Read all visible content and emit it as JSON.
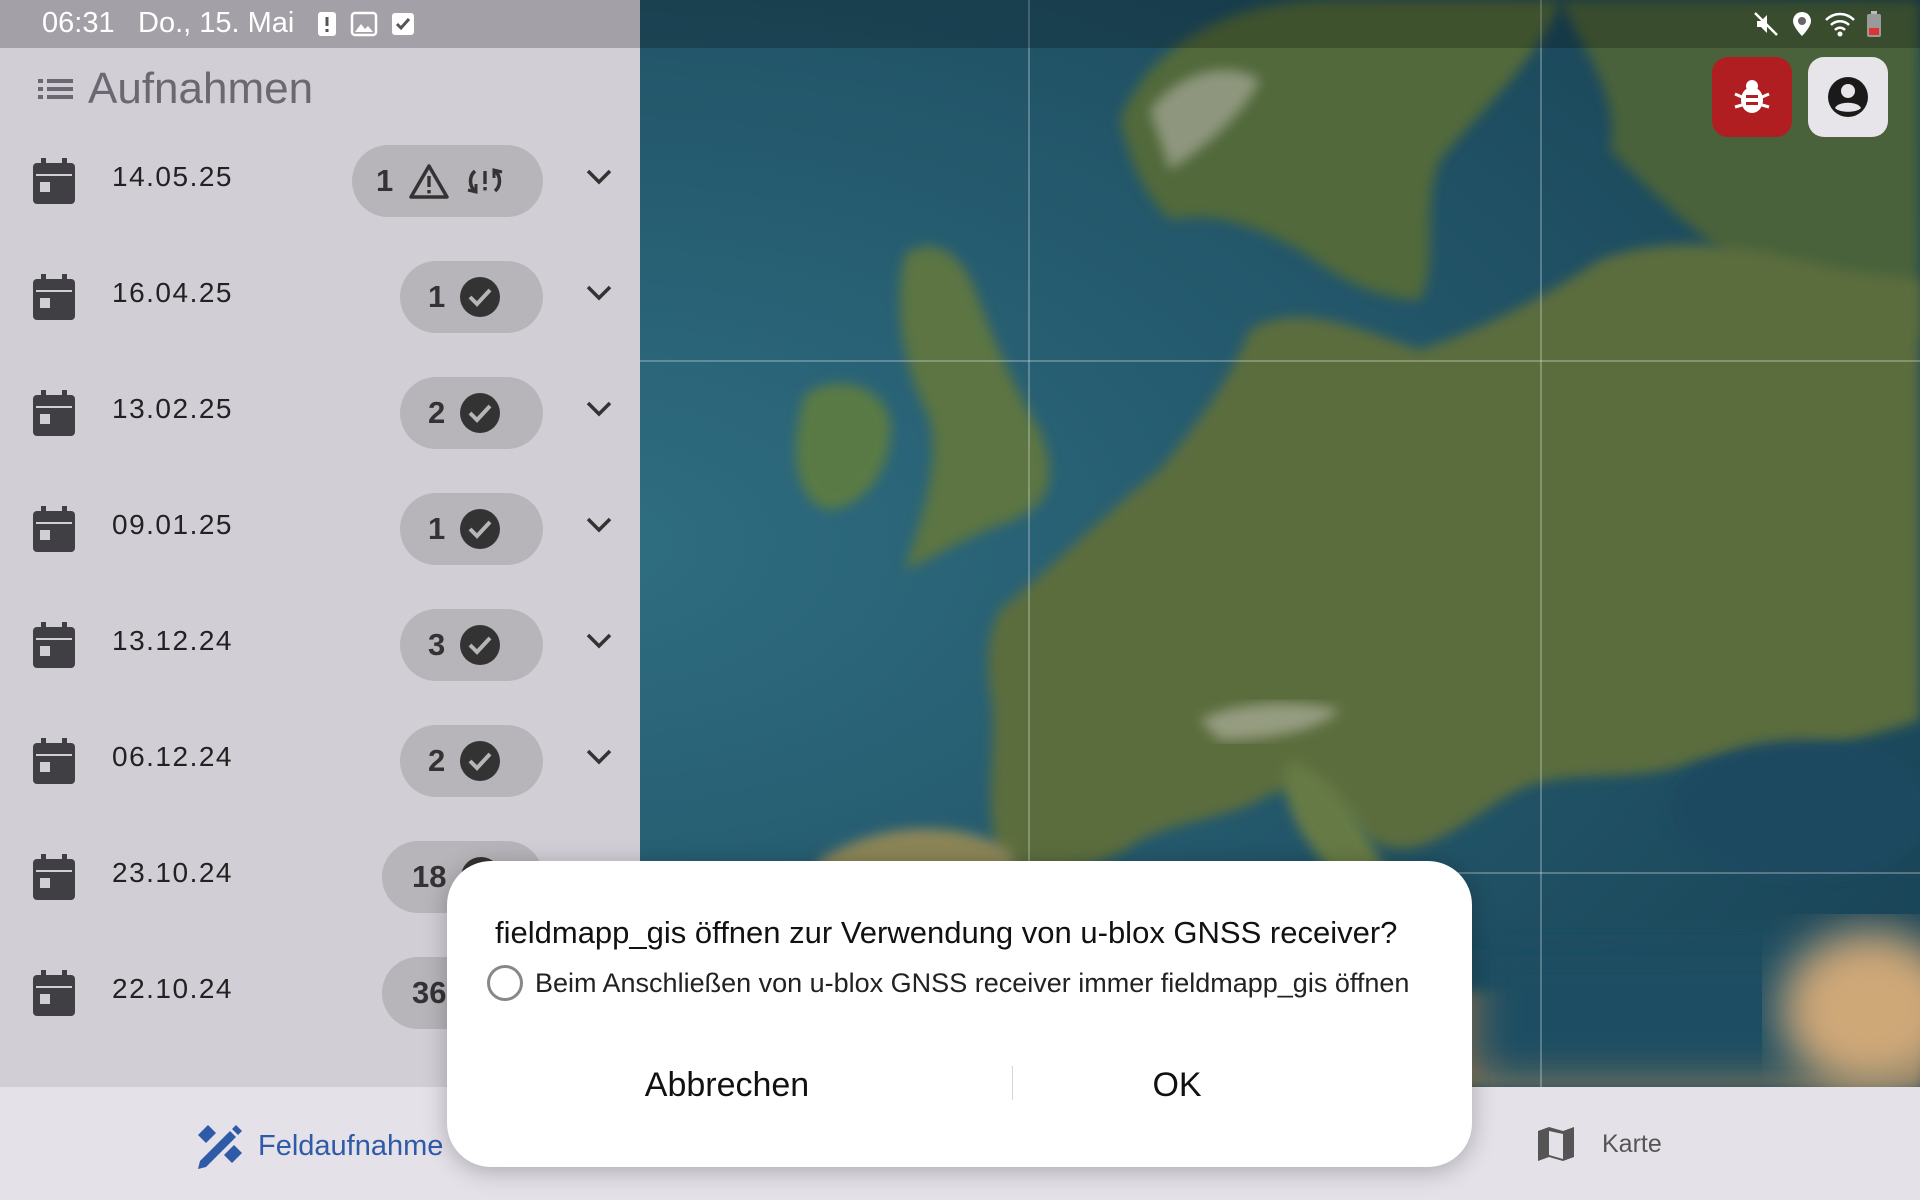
{
  "status_bar": {
    "time": "06:31",
    "date": "Do., 15. Mai",
    "left_icons": [
      "alert-icon",
      "image-icon",
      "checkbox-icon"
    ],
    "right_icons": [
      "mute-icon",
      "location-icon",
      "wifi-icon",
      "battery-low-icon"
    ]
  },
  "panel": {
    "title": "Aufnahmen",
    "menu_icon": "list-icon",
    "rows": [
      {
        "date": "14.05.25",
        "count": "1",
        "status": "warning-sync"
      },
      {
        "date": "16.04.25",
        "count": "1",
        "status": "done"
      },
      {
        "date": "13.02.25",
        "count": "2",
        "status": "done"
      },
      {
        "date": "09.01.25",
        "count": "1",
        "status": "done"
      },
      {
        "date": "13.12.24",
        "count": "3",
        "status": "done"
      },
      {
        "date": "06.12.24",
        "count": "2",
        "status": "done"
      },
      {
        "date": "23.10.24",
        "count": "18",
        "status": "done"
      },
      {
        "date": "22.10.24",
        "count": "36",
        "status": "done"
      }
    ]
  },
  "top_buttons": {
    "bug": "bug-icon",
    "account": "account-icon",
    "bug_color": "#b01e22"
  },
  "bottom_nav": {
    "field_label": "Feldaufnahme",
    "map_label": "Karte",
    "active_color": "#2e5aa8"
  },
  "dialog": {
    "title": "fieldmapp_gis öffnen zur Verwendung von u-blox GNSS receiver?",
    "checkbox_label": "Beim Anschließen von u-blox GNSS receiver immer fieldmapp_gis öffnen",
    "checkbox_checked": false,
    "cancel_label": "Abbrechen",
    "ok_label": "OK"
  }
}
